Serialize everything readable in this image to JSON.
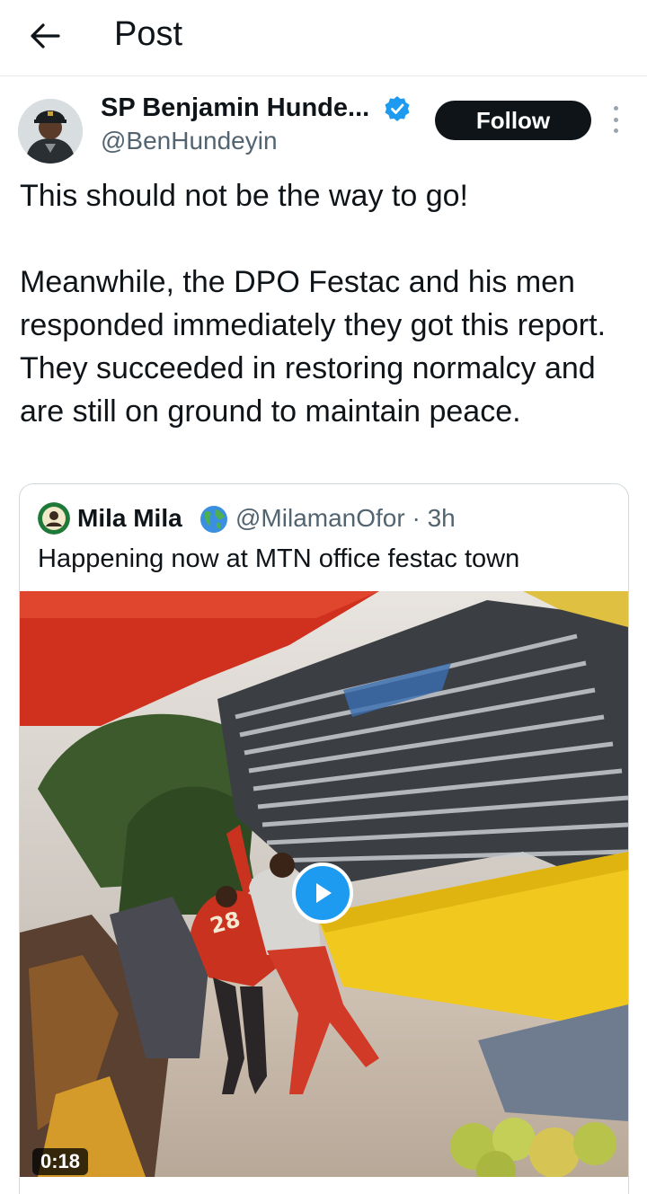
{
  "header": {
    "back_icon": "arrow-left-icon",
    "title": "Post"
  },
  "author": {
    "display_name": "SP Benjamin Hunde...",
    "handle": "@BenHundeyin",
    "verified_icon": "verified-badge-icon",
    "follow_label": "Follow",
    "more_icon": "more-vertical-icon"
  },
  "post": {
    "text": "This should not be the way to go!\n\nMeanwhile, the DPO Festac and his men responded immediately they got this report. They succeeded in restoring normalcy and are still on ground to maintain peace."
  },
  "quote": {
    "name": "Mila Mila",
    "emoji_icon": "globe-emoji-icon",
    "handle": "@MilamanOfor",
    "separator": "·",
    "time": "3h",
    "text": "Happening now at MTN office festac town",
    "video": {
      "play_icon": "play-icon",
      "duration": "0:18"
    }
  },
  "colors": {
    "text": "#0f1419",
    "secondary": "#536471",
    "accent": "#1d9bf0",
    "border": "#cfd9de"
  }
}
